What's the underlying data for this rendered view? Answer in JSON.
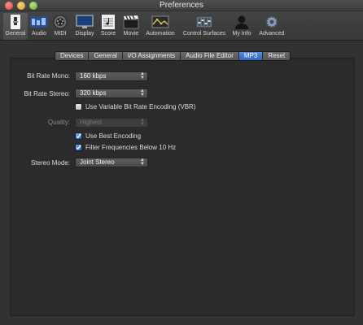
{
  "window": {
    "title": "Preferences"
  },
  "toolbar": {
    "items": [
      {
        "label": "General"
      },
      {
        "label": "Audio"
      },
      {
        "label": "MIDI"
      },
      {
        "label": "Display"
      },
      {
        "label": "Score"
      },
      {
        "label": "Movie"
      },
      {
        "label": "Automation"
      },
      {
        "label": "Control Surfaces"
      },
      {
        "label": "My Info"
      },
      {
        "label": "Advanced"
      }
    ]
  },
  "tabs": [
    "Devices",
    "General",
    "I/O Assignments",
    "Audio File Editor",
    "MP3",
    "Reset"
  ],
  "form": {
    "bit_rate_mono": {
      "label": "Bit Rate Mono:",
      "value": "160 kbps"
    },
    "bit_rate_stereo": {
      "label": "Bit Rate Stereo:",
      "value": "320 kbps"
    },
    "vbr": {
      "label": "Use Variable Bit Rate Encoding (VBR)",
      "checked": false
    },
    "quality": {
      "label": "Quality:",
      "value": "Highest"
    },
    "best_encoding": {
      "label": "Use Best Encoding",
      "checked": true
    },
    "filter": {
      "label": "Filter Frequencies Below 10 Hz",
      "checked": true
    },
    "stereo_mode": {
      "label": "Stereo Mode:",
      "value": "Joint Stereo"
    }
  },
  "colors": {
    "accent": "#3a73d6",
    "panel": "#2b2b2b",
    "window": "#323232"
  }
}
